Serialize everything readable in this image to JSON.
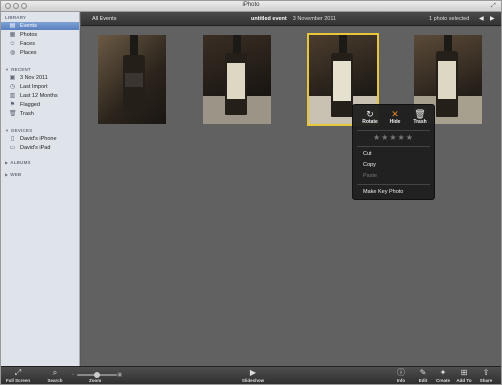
{
  "window": {
    "title": "iPhoto"
  },
  "sidebar": {
    "library_heading": "LIBRARY",
    "library_items": [
      {
        "label": "Events",
        "icon": "events-icon"
      },
      {
        "label": "Photos",
        "icon": "photos-icon"
      },
      {
        "label": "Faces",
        "icon": "faces-icon"
      },
      {
        "label": "Places",
        "icon": "places-icon"
      }
    ],
    "recent_heading": "RECENT",
    "recent_items": [
      {
        "label": "3 Nov 2011",
        "icon": "event-icon"
      },
      {
        "label": "Last Import",
        "icon": "clock-icon"
      },
      {
        "label": "Last 12 Months",
        "icon": "calendar-icon"
      },
      {
        "label": "Flagged",
        "icon": "flag-icon"
      },
      {
        "label": "Trash",
        "icon": "trash-icon"
      }
    ],
    "devices_heading": "DEVICES",
    "devices_items": [
      {
        "label": "David's iPhone",
        "icon": "iphone-icon"
      },
      {
        "label": "David's iPad",
        "icon": "ipad-icon"
      }
    ],
    "albums_heading": "ALBUMS",
    "web_heading": "WEB"
  },
  "topbar": {
    "all_events": "All Events",
    "event_name": "untitled event",
    "event_date": "3 November 2011",
    "selection": "1 photo selected"
  },
  "context_menu": {
    "rotate": "Rotate",
    "hide": "Hide",
    "trash": "Trash",
    "stars": "★★★★★",
    "cut": "Cut",
    "copy": "Copy",
    "paste": "Paste",
    "make_key_photo": "Make Key Photo"
  },
  "bottombar": {
    "full_screen": "Full Screen",
    "search": "Search",
    "zoom": "Zoom",
    "slideshow": "Slideshow",
    "info": "Info",
    "edit": "Edit",
    "create": "Create",
    "add_to": "Add To",
    "share": "Share"
  },
  "colors": {
    "selection_outline": "#e7c63a",
    "sidebar_selected": "#5a80bf"
  }
}
